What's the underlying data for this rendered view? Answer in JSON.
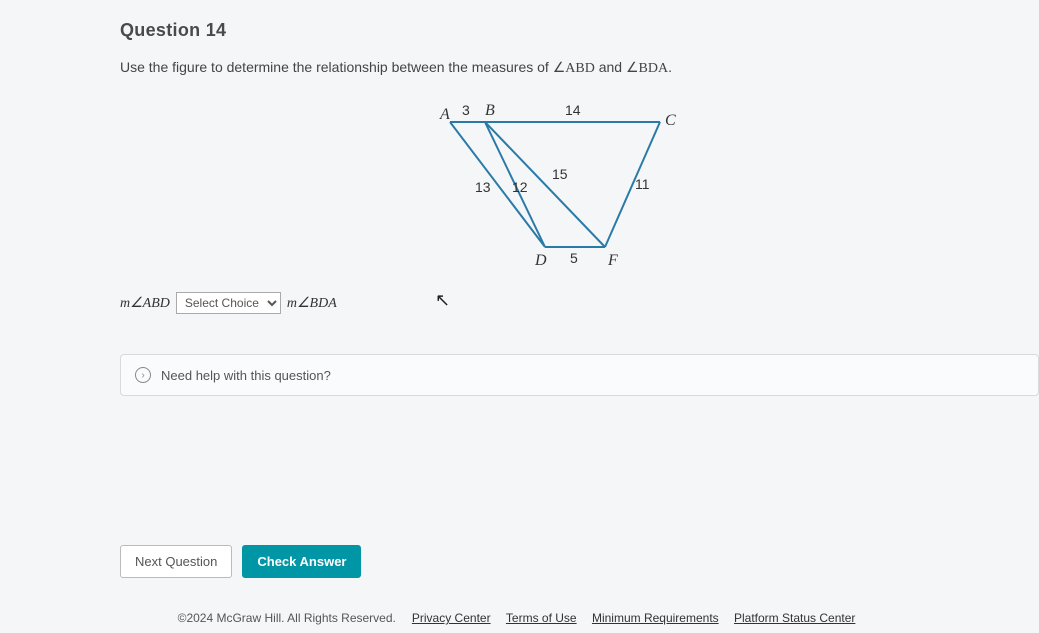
{
  "question": {
    "title": "Question 14",
    "prompt_prefix": "Use the figure to determine the relationship between the measures of ",
    "angle1": "∠ABD",
    "prompt_mid": " and ",
    "angle2": "∠BDA",
    "prompt_suffix": "."
  },
  "figure": {
    "vertices": {
      "A": "A",
      "B": "B",
      "C": "C",
      "D": "D",
      "F": "F"
    },
    "edges": {
      "AB": "3",
      "BC": "14",
      "AD": "13",
      "BD": "12",
      "BF": "15",
      "CF": "11",
      "DF": "5"
    }
  },
  "answer": {
    "left": "m∠ABD",
    "select_placeholder": "Select Choice",
    "right": "m∠BDA"
  },
  "help": {
    "text": "Need help with this question?"
  },
  "buttons": {
    "next": "Next Question",
    "check": "Check Answer"
  },
  "footer": {
    "copyright": "©2024 McGraw Hill. All Rights Reserved.",
    "links": {
      "privacy": "Privacy Center",
      "terms": "Terms of Use",
      "minreq": "Minimum Requirements",
      "status": "Platform Status Center"
    }
  }
}
